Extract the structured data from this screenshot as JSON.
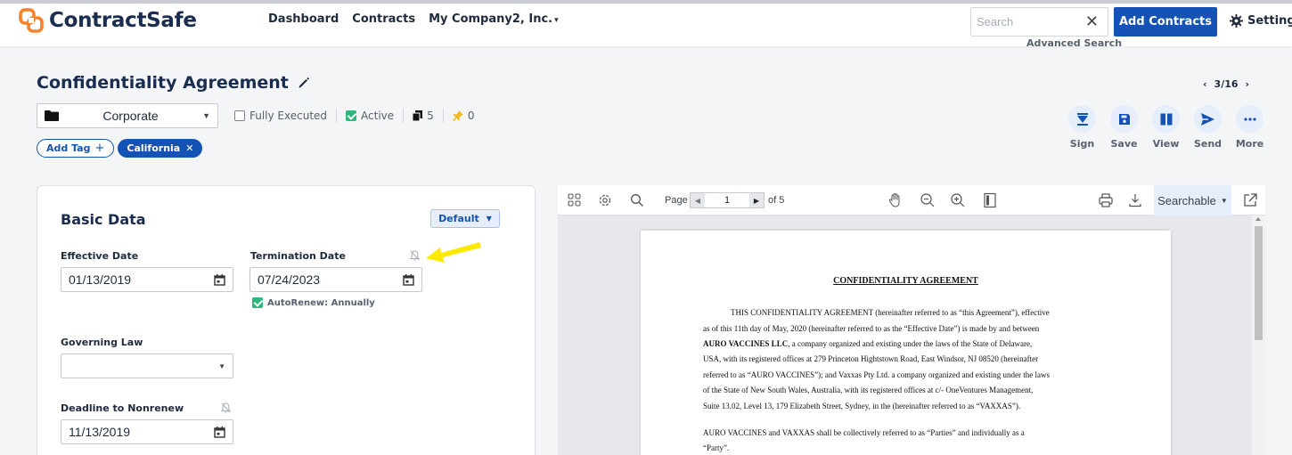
{
  "app": {
    "brand": "ContractSafe",
    "colors": {
      "primary": "#1453b5",
      "brand_orange": "#f5822b",
      "success": "#2fb67a",
      "highlight_arrow": "#ffe800"
    }
  },
  "nav": {
    "dashboard": "Dashboard",
    "contracts": "Contracts",
    "company": "My Company2, Inc."
  },
  "search": {
    "placeholder": "Search",
    "value": "",
    "advanced": "Advanced Search"
  },
  "header_actions": {
    "add_contracts": "Add Contracts",
    "settings": "Settings"
  },
  "contract": {
    "title": "Confidentiality Agreement",
    "pager": "3/16",
    "folder": "Corporate",
    "fully_executed_label": "Fully Executed",
    "fully_executed": false,
    "active_label": "Active",
    "active": true,
    "file_count": "5",
    "pin_count": "0",
    "tags": {
      "add_label": "Add Tag",
      "items": [
        "California"
      ]
    }
  },
  "actions": [
    {
      "icon": "sign-icon",
      "label": "Sign"
    },
    {
      "icon": "save-icon",
      "label": "Save"
    },
    {
      "icon": "view-icon",
      "label": "View"
    },
    {
      "icon": "send-icon",
      "label": "Send"
    },
    {
      "icon": "more-icon",
      "label": "More"
    }
  ],
  "basic_data": {
    "title": "Basic Data",
    "view_select": "Default",
    "effective_date_label": "Effective Date",
    "effective_date": "01/13/2019",
    "termination_date_label": "Termination Date",
    "termination_date": "07/24/2023",
    "autorenew_label": "AutoRenew: Annually",
    "autorenew": true,
    "governing_law_label": "Governing Law",
    "governing_law": "",
    "deadline_label": "Deadline to Nonrenew",
    "deadline": "11/13/2019"
  },
  "viewer": {
    "page_label": "Page",
    "current_page": "1",
    "page_total": "of 5",
    "searchable": "Searchable",
    "document": {
      "heading": "CONFIDENTIALITY AGREEMENT",
      "lines": [
        "THIS CONFIDENTIALITY AGREEMENT (hereinafter referred to as “this Agreement”), effective",
        "as of this 11th day of May, 2020 (hereinafter referred to as the “Effective Date”) is made by and between",
        "AURO VACCINES LLC, a company organized and existing under the laws of the State of Delaware,",
        "USA, with its registered offices at 279 Princeton Hightstown Road, East Windsor, NJ 08520 (hereinafter",
        "referred to as “AURO VACCINES”); and Vaxxas Pty Ltd. a company organized and existing under the laws",
        "of the State of New South Wales, Australia, with its registered offices at c/- OneVentures Management,",
        "Suite 13.02, Level 13, 179 Elizabeth Street, Sydney, in the (hereinafter referred to as “VAXXAS”).",
        "AURO VACCINES and VAXXAS shall be collectively referred to as “Parties” and individually as a",
        "“Party”."
      ]
    }
  }
}
